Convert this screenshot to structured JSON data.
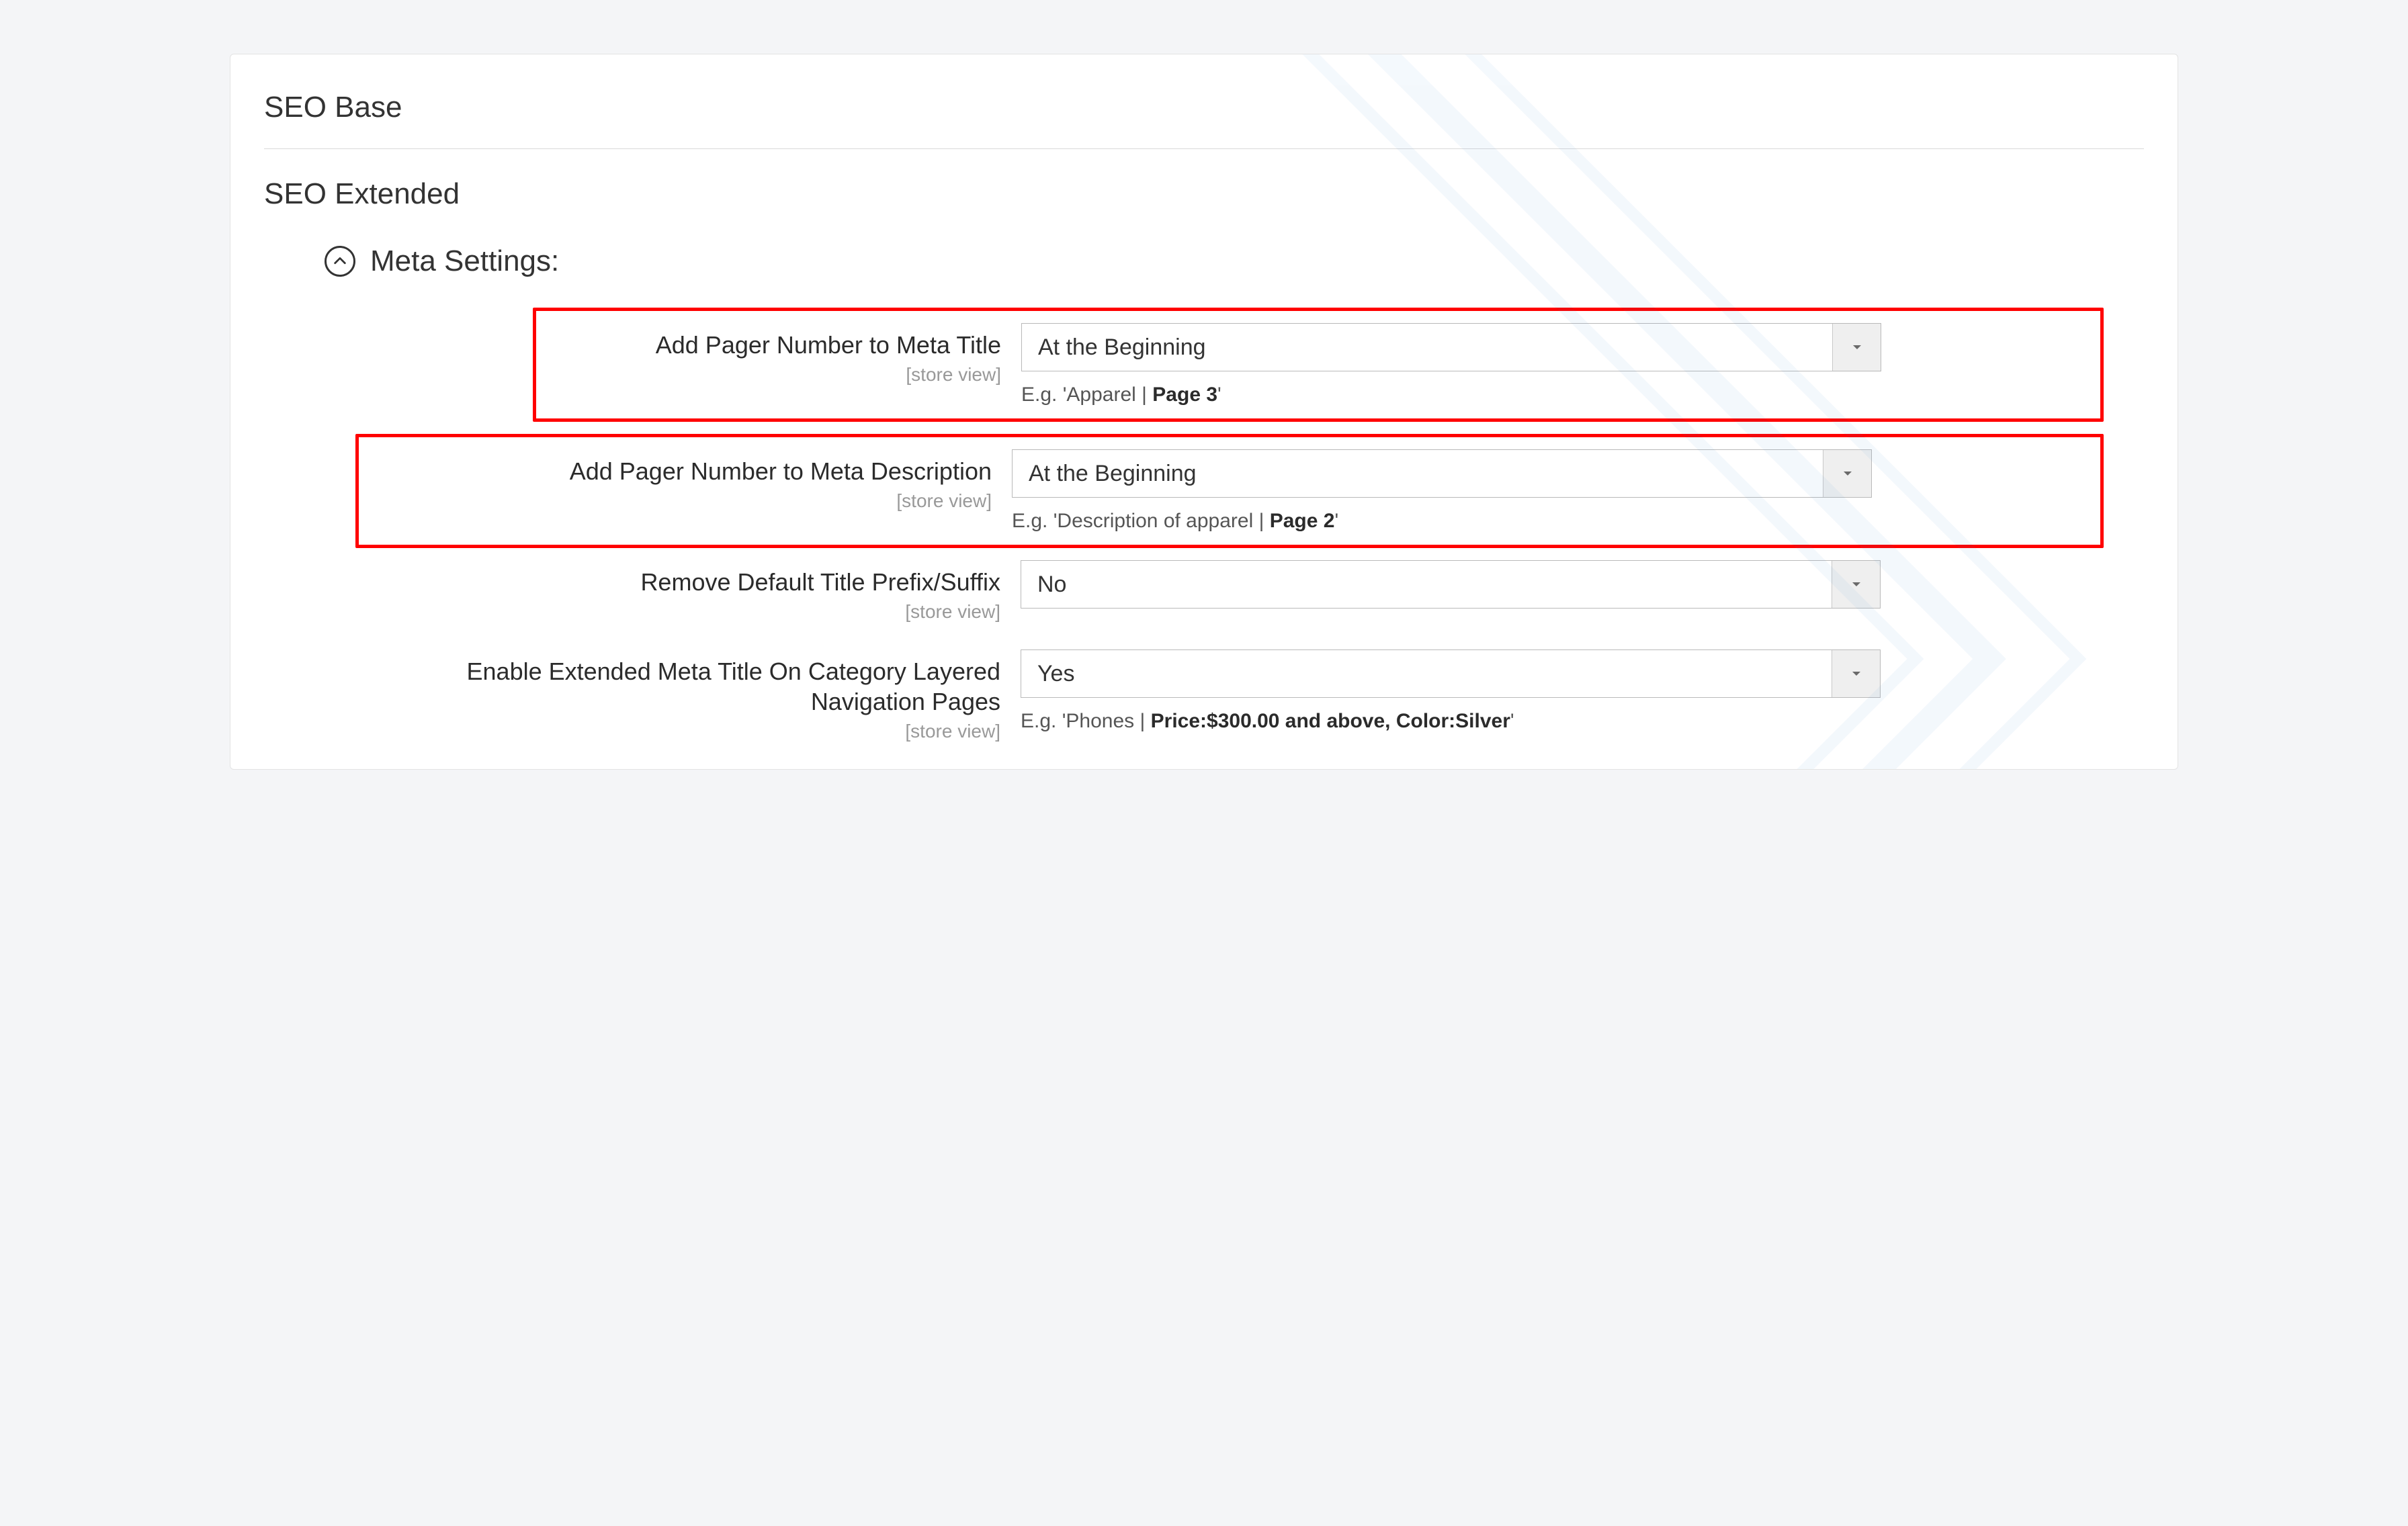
{
  "sections": {
    "seo_base_title": "SEO Base",
    "seo_extended_title": "SEO Extended"
  },
  "group": {
    "title": "Meta Settings:"
  },
  "scope_label": "[store view]",
  "fields": {
    "pager_title": {
      "label": "Add Pager Number to Meta Title",
      "value": "At the Beginning",
      "hint_pre": "E.g. 'Apparel | ",
      "hint_bold": "Page 3",
      "hint_post": "'"
    },
    "pager_desc": {
      "label": "Add Pager Number to Meta Description",
      "value": "At the Beginning",
      "hint_pre": "E.g. 'Description of apparel | ",
      "hint_bold": "Page 2",
      "hint_post": "'"
    },
    "remove_prefix": {
      "label": "Remove Default Title Prefix/Suffix",
      "value": "No"
    },
    "extended_layered": {
      "label": "Enable Extended Meta Title On Category Layered Navigation Pages",
      "value": "Yes",
      "hint_pre": "E.g. 'Phones | ",
      "hint_bold": "Price:$300.00 and above, Color:Silver",
      "hint_post": "'"
    }
  }
}
